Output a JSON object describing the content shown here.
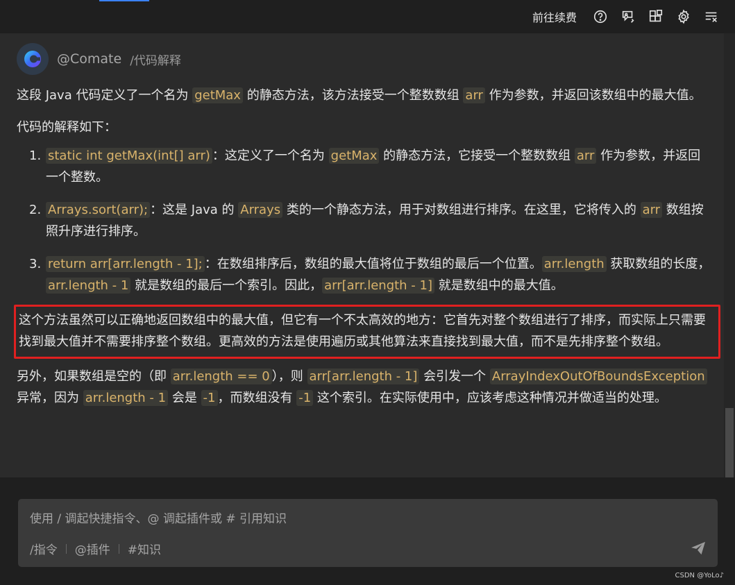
{
  "topbar": {
    "renew_label": "前往续费"
  },
  "message": {
    "bot_name": "@Comate",
    "command": "/代码解释",
    "p1": {
      "t1": "这段 Java 代码定义了一个名为 ",
      "c1": "getMax",
      "t2": " 的静态方法，该方法接受一个整数数组 ",
      "c2": "arr",
      "t3": " 作为参数，并返回该数组中的最大值。"
    },
    "p2": "代码的解释如下：",
    "items": [
      {
        "num": "1.",
        "c1": "static int getMax(int[] arr)",
        "t1": "：这定义了一个名为 ",
        "c2": "getMax",
        "t2": " 的静态方法，它接受一个整数数组 ",
        "c3": "arr",
        "t3": " 作为参数，并返回一个整数。"
      },
      {
        "num": "2.",
        "c1": "Arrays.sort(arr);",
        "t1": "：这是 Java 的 ",
        "c2": "Arrays",
        "t2": " 类的一个静态方法，用于对数组进行排序。在这里，它将传入的 ",
        "c3": "arr",
        "t3": " 数组按照升序进行排序。"
      },
      {
        "num": "3.",
        "c1": "return arr[arr.length - 1];",
        "t1": "：在数组排序后，数组的最大值将位于数组的最后一个位置。",
        "c2": "arr.length",
        "t2": " 获取数组的长度，",
        "c3": "arr.length - 1",
        "t3": " 就是数组的最后一个索引。因此，",
        "c4": "arr[arr.length - 1]",
        "t4": " 就是数组中的最大值。"
      }
    ],
    "highlight": "这个方法虽然可以正确地返回数组中的最大值，但它有一个不太高效的地方：它首先对整个数组进行了排序，而实际上只需要找到最大值并不需要排序整个数组。更高效的方法是使用遍历或其他算法来直接找到最大值，而不是先排序整个数组。",
    "p_last": {
      "t1": "另外，如果数组是空的（即 ",
      "c1": "arr.length == 0",
      "t2": "），则 ",
      "c2": "arr[arr.length - 1]",
      "t3": " 会引发一个 ",
      "c3": "ArrayIndexOutOfBoundsException",
      "t4": " 异常，因为 ",
      "c4": "arr.length - 1",
      "t5": " 会是 ",
      "c5": "-1",
      "t6": "，而数组没有 ",
      "c6": "-1",
      "t7": " 这个索引。在实际使用中，应该考虑这种情况并做适当的处理。"
    }
  },
  "composer": {
    "placeholder": "使用 / 调起快捷指令、@ 调起插件或 # 引用知识",
    "shortcut_command": "/指令",
    "shortcut_plugin": "@插件",
    "shortcut_knowledge": "#知识"
  },
  "watermark": "CSDN @YoLo♪",
  "colors": {
    "highlight_border": "#e02020",
    "code_text": "#d9b36b",
    "code_bg": "#3b3b36",
    "accent": "#3b82f6"
  },
  "icons": [
    "help-icon",
    "feedback-icon",
    "apps-icon",
    "gear-icon",
    "clear-list-icon",
    "send-icon",
    "comate-logo-icon"
  ]
}
